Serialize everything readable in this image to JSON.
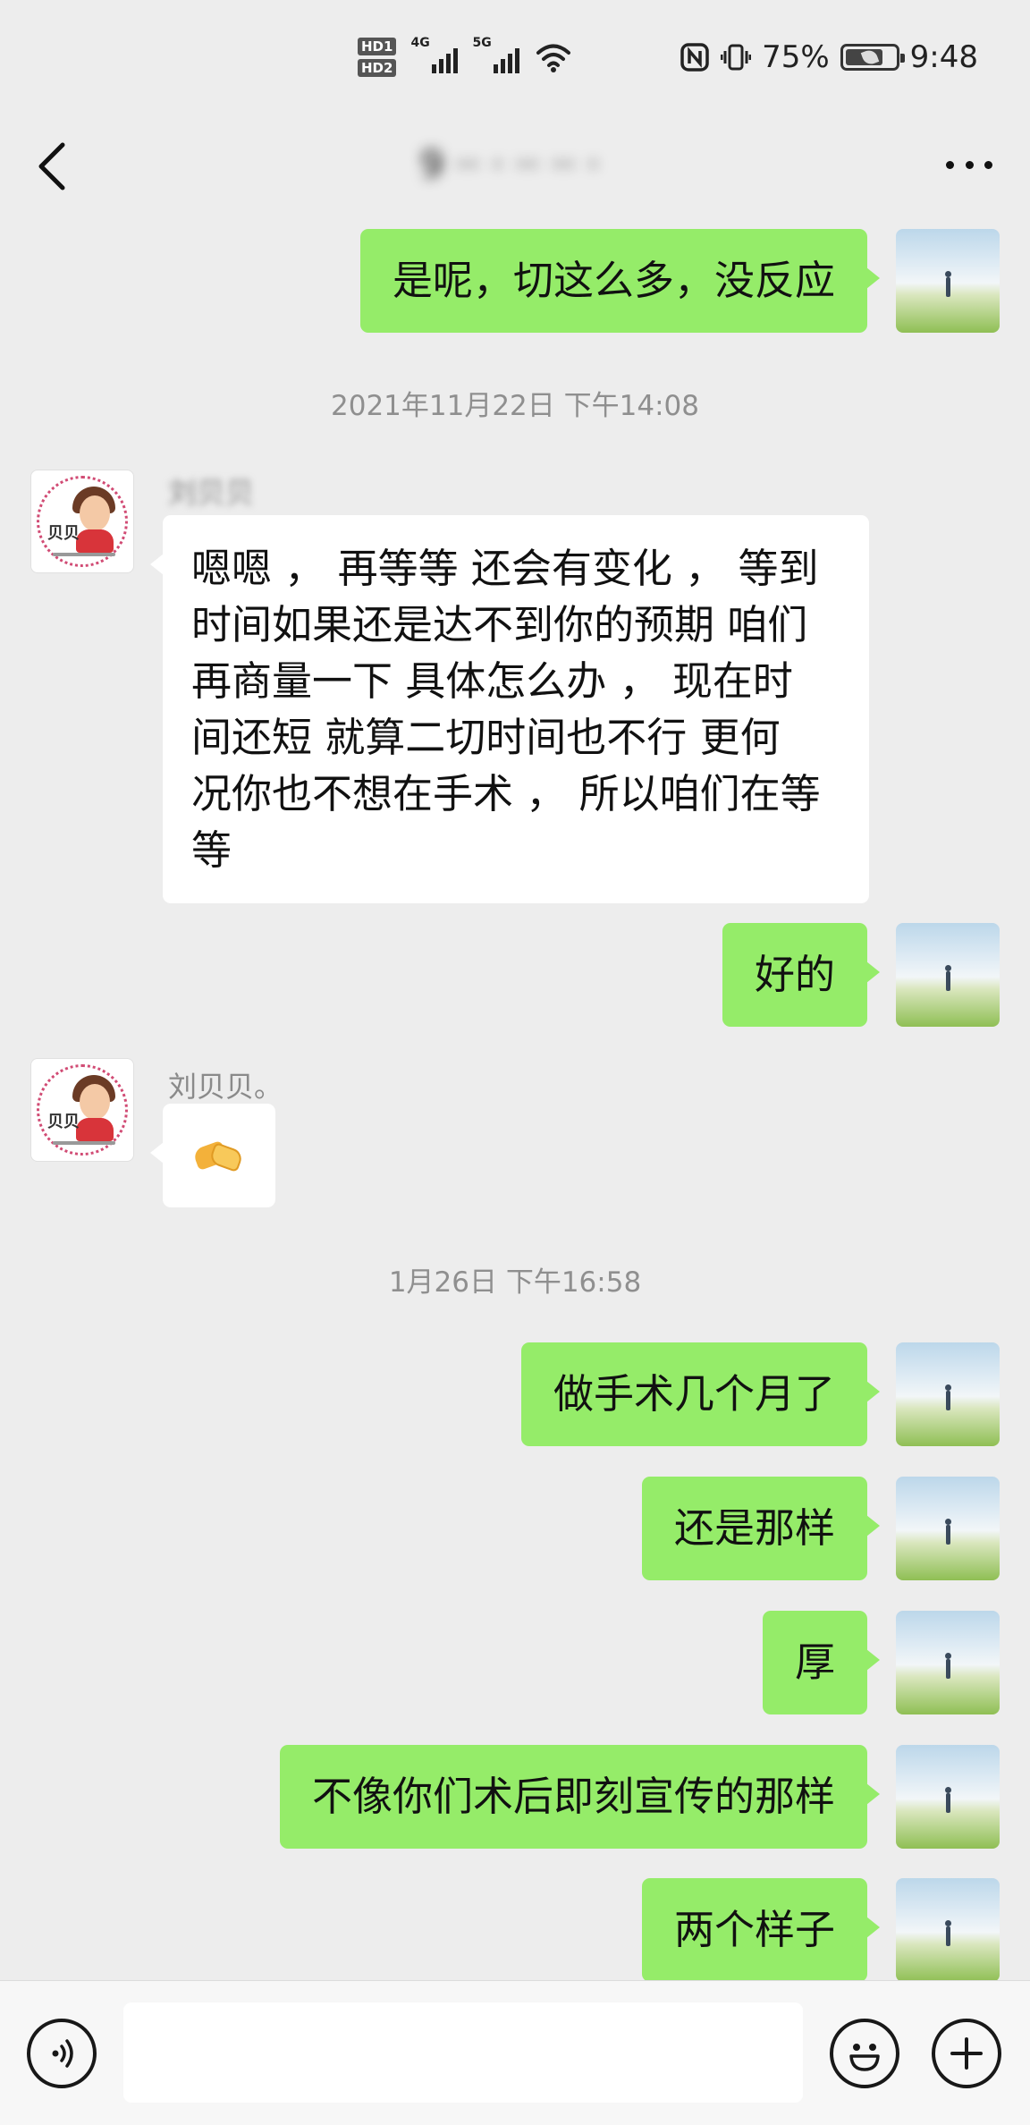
{
  "status_bar": {
    "hd1": "HD1",
    "hd2": "HD2",
    "sim1_network": "4G",
    "sim2_network": "5G",
    "battery_percent": "75%",
    "battery_level": 0.75,
    "time": "9:48"
  },
  "header": {
    "title": "9 ·· · ·· ·· ·",
    "back_icon": "chevron-left-icon",
    "more_icon": "more-dots-icon"
  },
  "messages": [
    {
      "id": "m1",
      "from": "me",
      "text": "是呢，切这么多，没反应"
    },
    {
      "id": "t1",
      "type": "timestamp",
      "text": "2021年11月22日 下午14:08"
    },
    {
      "id": "m2",
      "from": "other",
      "sender": "刘贝贝",
      "lines": [
        "嗯嗯 ， 再等等 还会有变化 ， 等到",
        "时间如果还是达不到你的预期 咱们",
        "再商量一下 具体怎么办 ， 现在时",
        "间还短 就算二切时间也不行 更何",
        "况你也不想在手术 ， 所以咱们在等",
        "等"
      ]
    },
    {
      "id": "m3",
      "from": "me",
      "text": "好的"
    },
    {
      "id": "m4",
      "from": "other",
      "sender": "刘贝贝。",
      "emoji": "handshake-icon"
    },
    {
      "id": "t2",
      "type": "timestamp",
      "text": "1月26日 下午16:58"
    },
    {
      "id": "m5",
      "from": "me",
      "text": "做手术几个月了"
    },
    {
      "id": "m6",
      "from": "me",
      "text": "还是那样"
    },
    {
      "id": "m7",
      "from": "me",
      "text": "厚"
    },
    {
      "id": "m8",
      "from": "me",
      "text": "不像你们术后即刻宣传的那样"
    },
    {
      "id": "m9",
      "from": "me",
      "text": "两个样子"
    }
  ],
  "input_bar": {
    "voice_icon": "voice-icon",
    "placeholder": "",
    "emoji_icon": "emoji-icon",
    "plus_icon": "plus-icon"
  },
  "colors": {
    "background": "#ededed",
    "my_bubble": "#95ec69",
    "other_bubble": "#ffffff",
    "timestamp": "#8f8f8f"
  }
}
